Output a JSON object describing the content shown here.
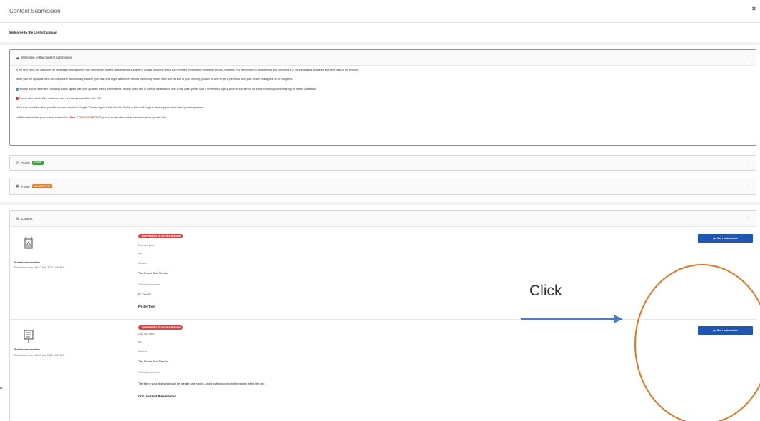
{
  "modal": {
    "title": "Content Submission",
    "close": "×",
    "welcome": "Welcome to the content upload"
  },
  "info_panel": {
    "title": "Welcome to the content submission",
    "paragraphs": [
      "In the next steps you will supply all necessary information for your programme content (presentations & posters). Upload your files, which you prepared following the guidelines for your congress. You might need to accept terms and conditions e.g. for Webcasting allowance and other data in the process.",
      "When your file upload is done and the system automatically checked your files (this might take some minutes depending on the traffic and the size of your content), you will be able to get a preview of how your content will appear at the congress.",
      "You will also be informed if blocking issues appear with your uploaded file(s). For example, missing video files or corrupt presentation files. In this case, please take a screenshot of your problem and send it via email to techsupport@avlar.org for further assistance.",
      "Please also note that the maximum size for each uploaded file is 5.0 GB.",
      "Make sure to use the latest possible browser version of Google Chrome, Apple Safari, Mozilla Firefox or Microsoft Edge to have support of the best upload experience."
    ],
    "deadline_prefix": "Until the deadline for your content submission - ",
    "deadline_value": "May 17 2023, 23:59 CEST",
    "deadline_suffix": " you can access the module here and upload updated files."
  },
  "profile_panel": {
    "title": "Profile",
    "badge": "DONE"
  },
  "photo_panel": {
    "title": "Photo",
    "badge": "INCOMPLETE"
  },
  "content_panel": {
    "title": "Content",
    "items": [
      {
        "status": "LIVE PRESENTATION FILE MISSING",
        "deadline_label": "Submission deadline",
        "deadline_value": "Submission open until 17 May 2023 11:59 PM",
        "date_label": "Date and place",
        "date_value": "-",
        "session_label": "Session",
        "session_value": "Test Poster Tour Session",
        "title_label": "Title of your content",
        "title_value": "PT Test 03",
        "type_value": "Poster Tour",
        "button": "Start submission"
      },
      {
        "status": "LIVE PRESENTATION FILE MISSING",
        "deadline_label": "Submission deadline",
        "deadline_value": "Submission open until 17 May 2023 11:59 PM",
        "date_label": "Date and place",
        "date_value": "-",
        "session_label": "Session",
        "session_value": "Test Poster Tour Session",
        "title_label": "Title of your content",
        "title_value": "The title of your abstract should be precise and explicit. Avoid putting too much information in the title line.",
        "type_value": "Oral Abstract Presentation",
        "button": "Start submission"
      }
    ]
  },
  "annotation": {
    "label": "Click",
    "color": "#e0751b",
    "arrow_color": "#4a7bc4"
  },
  "colors": {
    "primary": "#1e56b5",
    "danger": "#d84545",
    "success": "#36a836",
    "warning": "#e07a23",
    "accent": "#4aa9c3"
  }
}
